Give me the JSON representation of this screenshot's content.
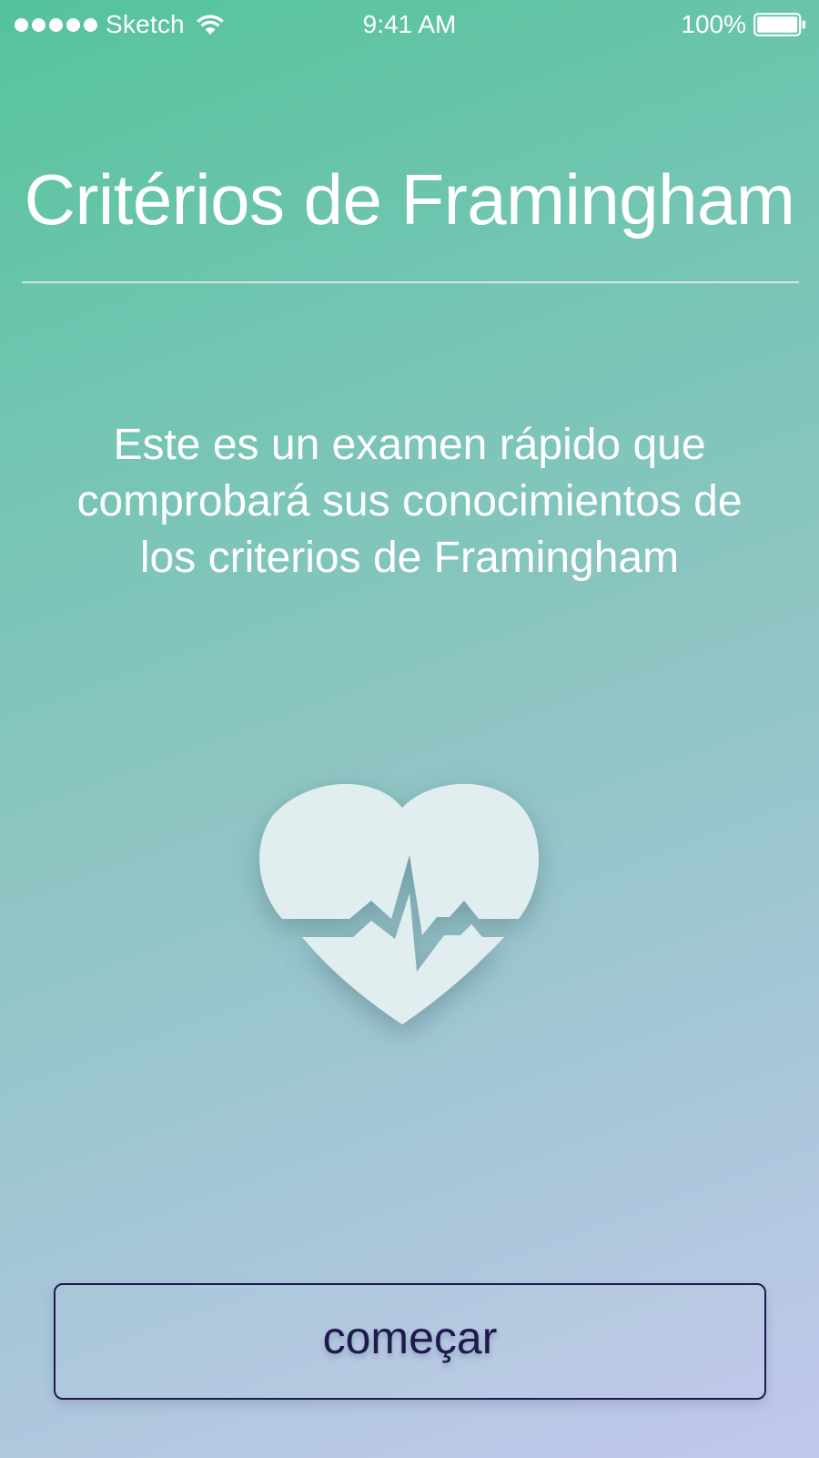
{
  "status_bar": {
    "carrier": "Sketch",
    "time": "9:41 AM",
    "battery_percent": "100%",
    "signal_icon": "signal-dots-icon",
    "wifi_icon": "wifi-icon",
    "battery_icon": "battery-icon"
  },
  "main": {
    "title": "Critérios de Framingham",
    "description": "Este es un examen rápido que comprobará sus conocimientos de los criterios de Framingham",
    "illustration_icon": "heart-pulse-icon"
  },
  "actions": {
    "start_label": "começar"
  },
  "colors": {
    "gradient_top": "#55c39b",
    "gradient_bottom": "#c2c7ee",
    "button_border": "#1f1a4e",
    "button_text": "#1f1a4e",
    "heart_fill": "#e1eeef",
    "text": "#ffffff"
  }
}
